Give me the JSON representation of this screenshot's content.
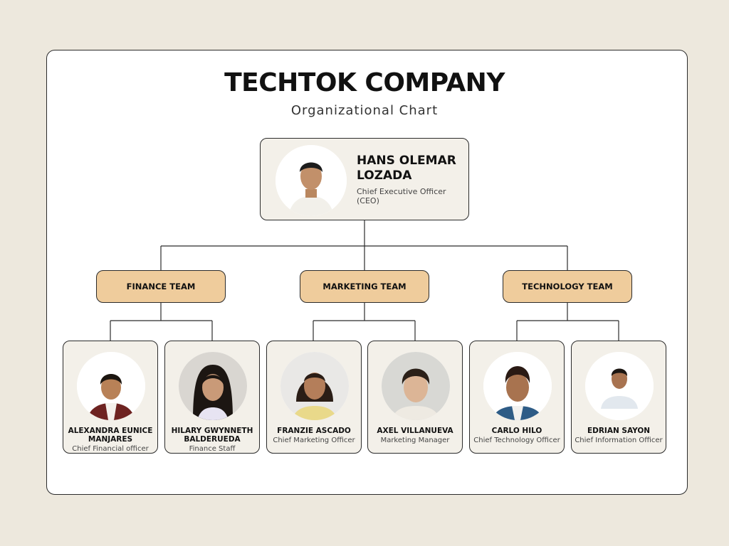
{
  "header": {
    "title": "TECHTOK COMPANY",
    "subtitle": "Organizational Chart"
  },
  "ceo": {
    "name": "HANS OLEMAR LOZADA",
    "role": "Chief Executive Officer (CEO)"
  },
  "teams": [
    {
      "label": "FINANCE TEAM",
      "members": [
        {
          "name": "ALEXANDRA EUNICE MANJARES",
          "role": "Chief Financial officer"
        },
        {
          "name": "HILARY GWYNNETH BALDERUEDA",
          "role": "Finance Staff"
        }
      ]
    },
    {
      "label": "MARKETING TEAM",
      "members": [
        {
          "name": "FRANZIE ASCADO",
          "role": "Chief Marketing Officer"
        },
        {
          "name": "AXEL VILLANUEVA",
          "role": "Marketing Manager"
        }
      ]
    },
    {
      "label": "TECHNOLOGY TEAM",
      "members": [
        {
          "name": "CARLO HILO",
          "role": "Chief Technology Officer"
        },
        {
          "name": "EDRIAN SAYON",
          "role": "Chief Information Officer"
        }
      ]
    }
  ],
  "colors": {
    "background": "#ede8dd",
    "card": "#ffffff",
    "node_fill": "#f3f0e9",
    "team_fill": "#efcc9c",
    "line": "#2b2b2b"
  }
}
